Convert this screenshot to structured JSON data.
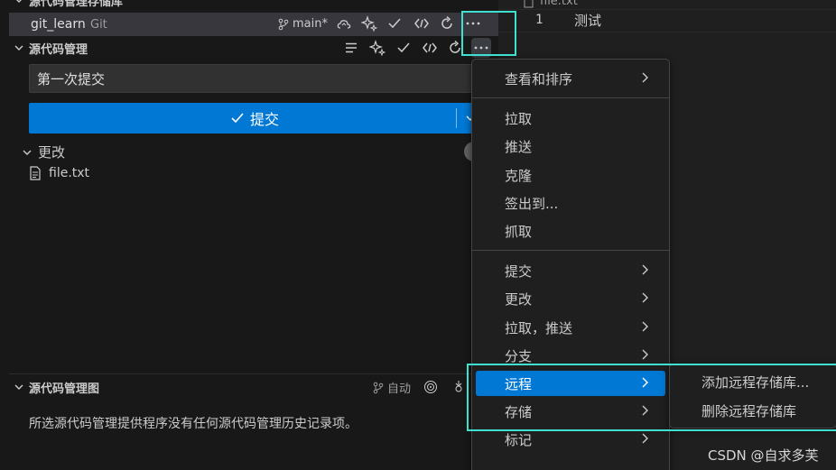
{
  "repositories": {
    "header": "源代码管理存储库",
    "repo_name": "git_learn",
    "provider": "Git",
    "branch": "main*"
  },
  "scm": {
    "header": "源代码管理",
    "commit_message": "第一次提交",
    "commit_button_label": "提交",
    "changes_label": "更改",
    "file_name": "file.txt"
  },
  "graph": {
    "header": "源代码管理图",
    "auto_label": "自动",
    "empty_message": "所选源代码管理提供程序没有任何源代码管理历史记录项。"
  },
  "editor": {
    "tab_file": "file.txt",
    "line_number": "1",
    "line_text": "测试"
  },
  "menu": {
    "items": [
      {
        "label": "查看和排序"
      },
      {
        "label": "拉取"
      },
      {
        "label": "推送"
      },
      {
        "label": "克隆"
      },
      {
        "label": "签出到..."
      },
      {
        "label": "抓取"
      },
      {
        "label": "提交"
      },
      {
        "label": "更改"
      },
      {
        "label": "拉取，推送"
      },
      {
        "label": "分支"
      },
      {
        "label": "远程"
      },
      {
        "label": "存储"
      },
      {
        "label": "标记"
      }
    ]
  },
  "submenu": {
    "items": [
      {
        "label": "添加远程存储库..."
      },
      {
        "label": "删除远程存储库"
      }
    ]
  },
  "watermark": "CSDN @自求多芙",
  "colors": {
    "accent": "#0078d4",
    "highlight_box": "#3ee0d0",
    "sidebar_bg": "#181818",
    "selected_row": "#37373d"
  }
}
